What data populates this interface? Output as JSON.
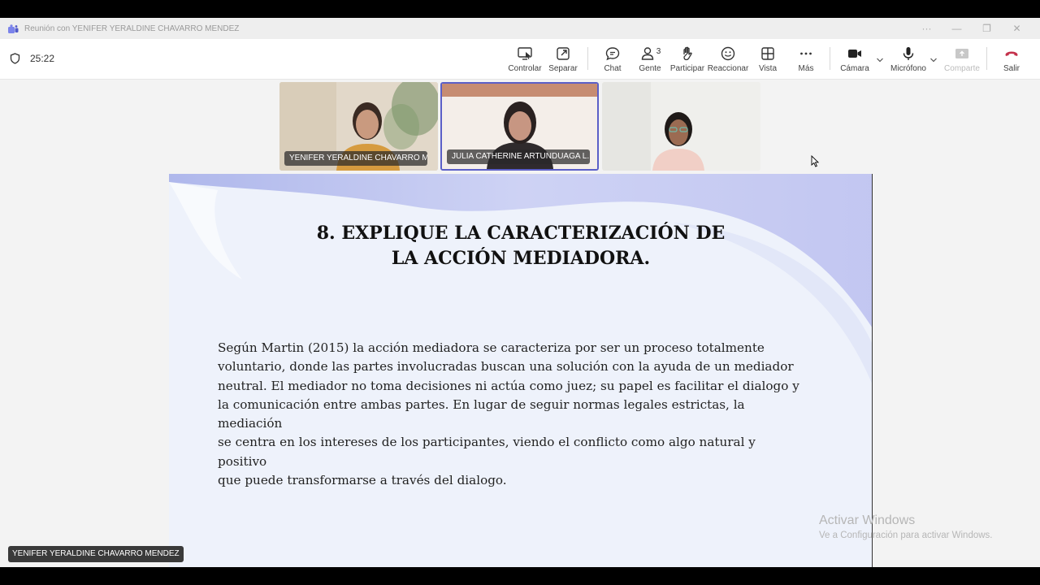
{
  "window": {
    "title": "Reunión con YENIFER YERALDINE CHAVARRO MENDEZ",
    "controls": [
      "···",
      "—",
      "❐",
      "✕"
    ]
  },
  "meeting": {
    "timer": "25:22"
  },
  "toolbar": {
    "controlar": "Controlar",
    "separar": "Separar",
    "chat": "Chat",
    "gente": "Gente",
    "gente_count": "3",
    "participar": "Participar",
    "reaccionar": "Reaccionar",
    "vista": "Vista",
    "mas": "Más",
    "camara": "Cámara",
    "microfono": "Micrófono",
    "compartir": "Comparte",
    "salir": "Salir",
    "accent_color": "#5b5fc7",
    "leave_color": "#c4314b"
  },
  "participants": [
    {
      "name": "YENIFER YERALDINE CHAVARRO M..."
    },
    {
      "name": "JULIA CATHERINE ARTUNDUAGA L..."
    },
    {
      "name": ""
    }
  ],
  "slide": {
    "title_line1": "8. EXPLIQUE LA CARACTERIZACIÓN DE",
    "title_line2": "LA ACCIÓN MEDIADORA.",
    "body_lines": [
      "Según Martin (2015) la acción mediadora se caracteriza por ser un proceso totalmente",
      "voluntario, donde las partes involucradas buscan una solución con la ayuda de un mediador",
      "neutral. El mediador no toma decisiones ni actúa como juez; su papel es facilitar el dialogo y",
      "la comunicación entre ambas partes. En lugar de seguir normas legales estrictas, la mediación",
      "se centra en los intereses de los participantes, viendo el conflicto como algo natural y positivo",
      "que puede transformarse a través del dialogo."
    ]
  },
  "watermark": {
    "line1": "Activar Windows",
    "line2": "Ve a Configuración para activar Windows."
  },
  "presenter_label": "YENIFER YERALDINE CHAVARRO MENDEZ"
}
